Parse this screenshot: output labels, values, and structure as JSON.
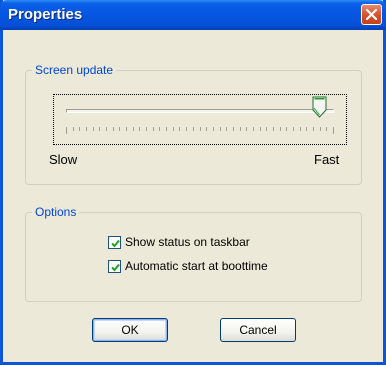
{
  "window": {
    "title": "Properties"
  },
  "screen_update": {
    "label": "Screen update",
    "slider": {
      "min_label": "Slow",
      "max_label": "Fast",
      "value_fraction": 1.0
    }
  },
  "options": {
    "label": "Options",
    "show_status": {
      "label": "Show status on taskbar",
      "checked": true
    },
    "auto_start": {
      "label": "Automatic start at boottime",
      "checked": true
    }
  },
  "buttons": {
    "ok": "OK",
    "cancel": "Cancel"
  },
  "colors": {
    "group_label": "#0046d5",
    "titlebar": "#0655e0",
    "dialog_bg": "#ece9d8"
  }
}
